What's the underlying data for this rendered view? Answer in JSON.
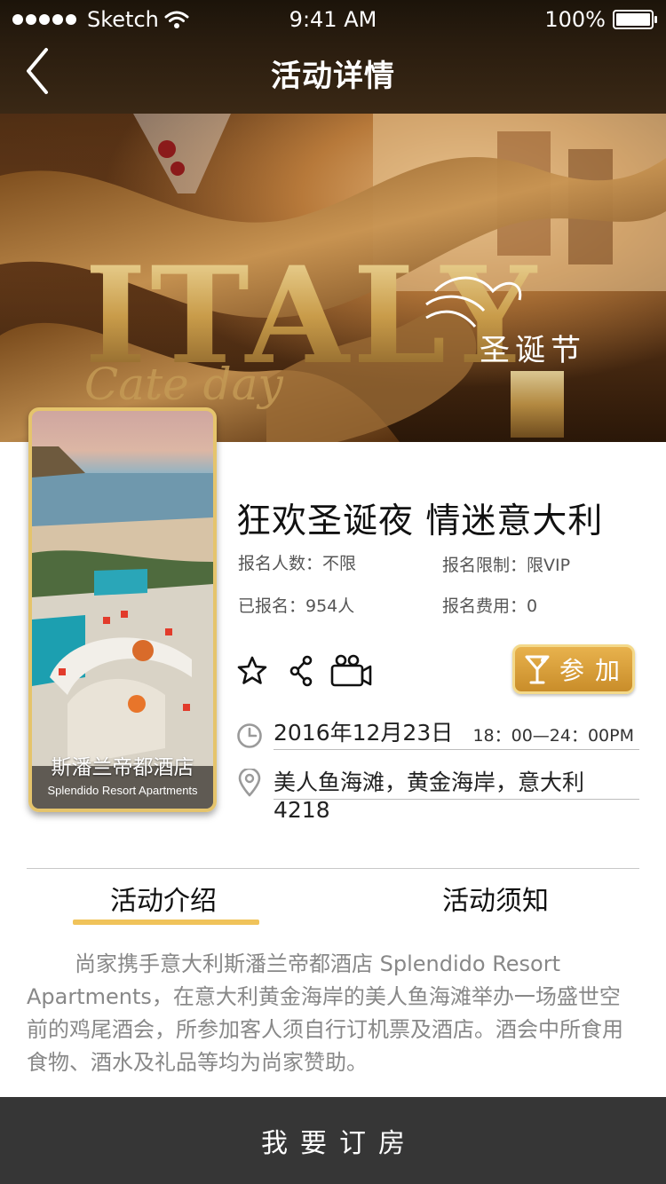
{
  "status_bar": {
    "carrier": "Sketch",
    "time": "9:41 AM",
    "battery": "100%"
  },
  "nav": {
    "title": "活动详情",
    "back_icon": "chevron-left-icon"
  },
  "banner": {
    "headline": "ITALY",
    "subtitle": "Cate day",
    "festival": "圣诞节"
  },
  "hotel": {
    "name": "斯潘兰帝都酒店",
    "name_en": "Splendido Resort Apartments"
  },
  "event": {
    "title": "狂欢圣诞夜 情迷意大利",
    "signup_count_label": "报名人数：不限",
    "signup_limit_label": "报名限制：限VIP",
    "registered_label": "已报名：954人",
    "fee_label": "报名费用：0",
    "join_label": "参加",
    "date": "2016年12月23日",
    "time": "18：00—24：00PM",
    "location": "美人鱼海滩，黄金海岸，意大利4218"
  },
  "icons": {
    "favorite": "star-icon",
    "share": "share-icon",
    "video": "video-camera-icon",
    "join": "cocktail-icon",
    "clock": "clock-icon",
    "location": "location-pin-icon"
  },
  "tabs": [
    {
      "label": "活动介绍",
      "active": true
    },
    {
      "label": "活动须知",
      "active": false
    }
  ],
  "intro_text": "尚家携手意大利斯潘兰帝都酒店 Splendido Resort Apartments，在意大利黄金海岸的美人鱼海滩举办一场盛世空前的鸡尾酒会，所参加客人须自行订机票及酒店。酒会中所食用食物、酒水及礼品等均为尚家赞助。",
  "footer": {
    "book_label": "我要订房"
  },
  "colors": {
    "accent_gold": "#f0c35a",
    "footer_bg": "#363636",
    "header_bg": "#2a1d0f"
  }
}
